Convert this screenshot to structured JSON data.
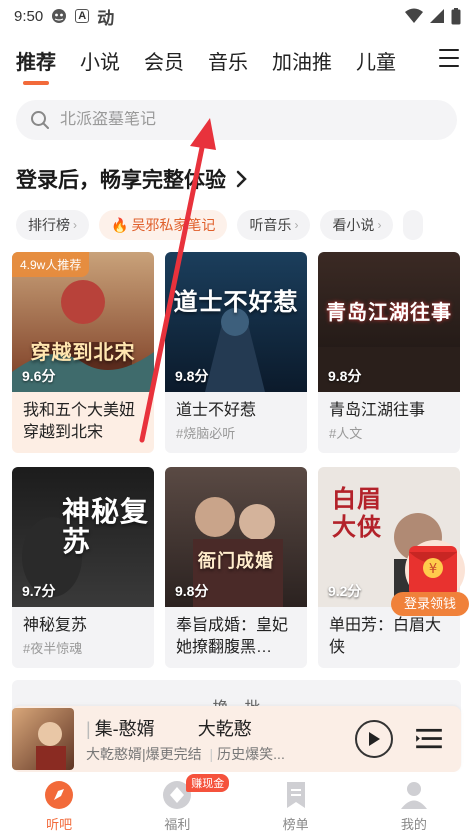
{
  "status_bar": {
    "time": "9:50",
    "app_glyph": "动"
  },
  "tabs": [
    {
      "label": "推荐",
      "active": true
    },
    {
      "label": "小说",
      "active": false
    },
    {
      "label": "会员",
      "active": false
    },
    {
      "label": "音乐",
      "active": false
    },
    {
      "label": "加油推",
      "active": false
    },
    {
      "label": "儿童",
      "active": false
    }
  ],
  "search": {
    "placeholder": "北派盗墓笔记"
  },
  "login_banner": {
    "text": "登录后，畅享完整体验"
  },
  "chips": [
    {
      "label": "排行榜"
    },
    {
      "label": "吴邪私家笔记"
    },
    {
      "label": "听音乐"
    },
    {
      "label": "看小说"
    }
  ],
  "cards": [
    {
      "title": "我和五个大美妞穿越到北宋",
      "tag": "",
      "score": "9.6分",
      "badge": "4.9w人推荐",
      "cover_text": "穿越到北宋"
    },
    {
      "title": "道士不好惹",
      "tag": "#烧脑必听",
      "score": "9.8分",
      "badge": "",
      "cover_text": "道士不好惹"
    },
    {
      "title": "青岛江湖往事",
      "tag": "#人文",
      "score": "9.8分",
      "badge": "",
      "cover_text": "青岛江湖往事"
    },
    {
      "title": "神秘复苏",
      "tag": "#夜半惊魂",
      "score": "9.7分",
      "badge": "",
      "cover_text": "神秘复苏"
    },
    {
      "title": "奉旨成婚：皇妃她撩翻腹黑…",
      "tag": "",
      "score": "9.8分",
      "badge": "",
      "cover_text": "衙门成婚"
    },
    {
      "title": "单田芳：白眉大侠",
      "tag": "",
      "score": "9.2分",
      "badge": "",
      "cover_text": "白眉大侠"
    }
  ],
  "refresh": {
    "label": "换一批"
  },
  "bonus": {
    "label": "登录领钱"
  },
  "player": {
    "title_a": "集-憨婿",
    "title_b": "大乾憨",
    "sub_a": "大乾憨婿|爆更完结",
    "sub_b": "历史爆笑..."
  },
  "bottom_nav": [
    {
      "label": "听吧",
      "active": true,
      "icon": "listen-icon"
    },
    {
      "label": "福利",
      "active": false,
      "icon": "gift-icon",
      "badge": "赚现金"
    },
    {
      "label": "榜单",
      "active": false,
      "icon": "bookmark-icon"
    },
    {
      "label": "我的",
      "active": false,
      "icon": "profile-icon"
    }
  ],
  "colors": {
    "accent": "#f26a3a",
    "arrow": "#e8323c"
  }
}
